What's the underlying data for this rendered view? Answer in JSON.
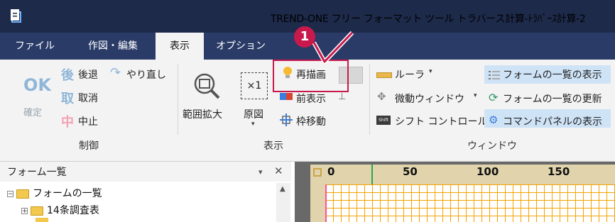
{
  "titlebar": {
    "title": "TREND-ONE フリー フォーマット ツール トラバース計算-ﾄﾗﾊﾞｰｽ計算-2"
  },
  "menu": {
    "tabs": [
      {
        "label": "ファイル"
      },
      {
        "label": "作図・編集"
      },
      {
        "label": "表示"
      },
      {
        "label": "オプション"
      }
    ]
  },
  "ribbon": {
    "control": {
      "ok": "OK",
      "confirm": "確定",
      "back": "後",
      "undo": "後退",
      "redo": "やり直し",
      "get": "取",
      "cancel": "取消",
      "mid": "中",
      "stop": "中止",
      "group": "制御"
    },
    "view": {
      "redraw": "再描画",
      "zoom_area": "範囲拡大",
      "original": "原図",
      "prev_view": "前表示",
      "frame_move": "枠移動",
      "group": "表示",
      "scale_text": "×1"
    },
    "window": {
      "ruler": "ルーラ",
      "micro_window": "微動ウィンドウ",
      "shift_control": "シフト コントロール",
      "form_list_show": "フォームの一覧の表示",
      "form_list_refresh": "フォームの一覧の更新",
      "command_panel": "コマンドパネルの表示",
      "shift_tag": "Shift",
      "group": "ウィンドウ"
    }
  },
  "callout": {
    "number": "1"
  },
  "form_panel": {
    "title": "フォーム一覧",
    "items": [
      {
        "label": "フォームの一覧"
      },
      {
        "label": "14条調査表"
      }
    ]
  },
  "ruler": {
    "ticks": [
      "0",
      "50",
      "100",
      "150"
    ]
  },
  "colors": {
    "accent": "#c8194d",
    "titlebar": "#1d2a4a",
    "menubar": "#2a3b67"
  }
}
